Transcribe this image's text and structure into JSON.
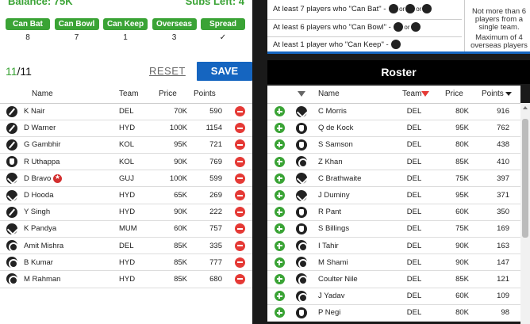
{
  "header": {
    "balance": "Balance: 75K",
    "subs_left": "Subs Left: 4"
  },
  "filters": [
    {
      "label": "Can Bat",
      "count": "8"
    },
    {
      "label": "Can Bowl",
      "count": "7"
    },
    {
      "label": "Can Keep",
      "count": "1"
    },
    {
      "label": "Overseas",
      "count": "3"
    },
    {
      "label": "Spread",
      "count": "✓"
    }
  ],
  "team_count": {
    "current": "11",
    "total": "/11"
  },
  "reset_label": "RESET",
  "save_label": "SAVE",
  "my_team": {
    "columns": {
      "name": "Name",
      "team": "Team",
      "price": "Price",
      "points": "Points"
    },
    "rows": [
      {
        "role": "bat",
        "name": "K Nair",
        "team": "DEL",
        "price": "70K",
        "points": "590"
      },
      {
        "role": "bat",
        "name": "D Warner",
        "team": "HYD",
        "price": "100K",
        "points": "1154"
      },
      {
        "role": "bat",
        "name": "G Gambhir",
        "team": "KOL",
        "price": "95K",
        "points": "721"
      },
      {
        "role": "keep",
        "name": "R Uthappa",
        "team": "KOL",
        "price": "90K",
        "points": "769"
      },
      {
        "role": "all",
        "name": "D Bravo",
        "team": "GUJ",
        "price": "100K",
        "points": "599"
      },
      {
        "role": "all",
        "name": "D Hooda",
        "team": "HYD",
        "price": "65K",
        "points": "269"
      },
      {
        "role": "bat",
        "name": "Y Singh",
        "team": "HYD",
        "price": "90K",
        "points": "222"
      },
      {
        "role": "all",
        "name": "K Pandya",
        "team": "MUM",
        "price": "60K",
        "points": "757"
      },
      {
        "role": "bowl",
        "name": "Amit Mishra",
        "team": "DEL",
        "price": "85K",
        "points": "335"
      },
      {
        "role": "bowl",
        "name": "B Kumar",
        "team": "HYD",
        "price": "85K",
        "points": "777"
      },
      {
        "role": "bowl",
        "name": "M Rahman",
        "team": "HYD",
        "price": "85K",
        "points": "680"
      }
    ]
  },
  "rules": {
    "bat": "At least 7 players who \"Can Bat\" -",
    "bowl": "At least 6 players who \"Can Bowl\" -",
    "keep": "At least 1 player who \"Can Keep\" -",
    "or": "or",
    "note1": "Not more than 6 players from a single team.",
    "note2": "Maximum of 4 overseas players"
  },
  "roster": {
    "title": "Roster",
    "columns": {
      "name": "Name",
      "team": "Team",
      "price": "Price",
      "points": "Points"
    },
    "rows": [
      {
        "role": "all",
        "name": "C Morris",
        "team": "DEL",
        "price": "80K",
        "points": "916"
      },
      {
        "role": "keep",
        "name": "Q de Kock",
        "team": "DEL",
        "price": "95K",
        "points": "762"
      },
      {
        "role": "keep",
        "name": "S Samson",
        "team": "DEL",
        "price": "80K",
        "points": "438"
      },
      {
        "role": "bowl",
        "name": "Z Khan",
        "team": "DEL",
        "price": "85K",
        "points": "410"
      },
      {
        "role": "all",
        "name": "C Brathwaite",
        "team": "DEL",
        "price": "75K",
        "points": "397"
      },
      {
        "role": "all",
        "name": "J Duminy",
        "team": "DEL",
        "price": "95K",
        "points": "371"
      },
      {
        "role": "keep",
        "name": "R Pant",
        "team": "DEL",
        "price": "60K",
        "points": "350"
      },
      {
        "role": "keep",
        "name": "S Billings",
        "team": "DEL",
        "price": "75K",
        "points": "169"
      },
      {
        "role": "bowl",
        "name": "I Tahir",
        "team": "DEL",
        "price": "90K",
        "points": "163"
      },
      {
        "role": "bowl",
        "name": "M Shami",
        "team": "DEL",
        "price": "90K",
        "points": "147"
      },
      {
        "role": "bowl",
        "name": "Coulter Nile",
        "team": "DEL",
        "price": "85K",
        "points": "121"
      },
      {
        "role": "bowl",
        "name": "J Yadav",
        "team": "DEL",
        "price": "60K",
        "points": "109"
      },
      {
        "role": "keep",
        "name": "P Negi",
        "team": "DEL",
        "price": "80K",
        "points": "98"
      }
    ]
  }
}
